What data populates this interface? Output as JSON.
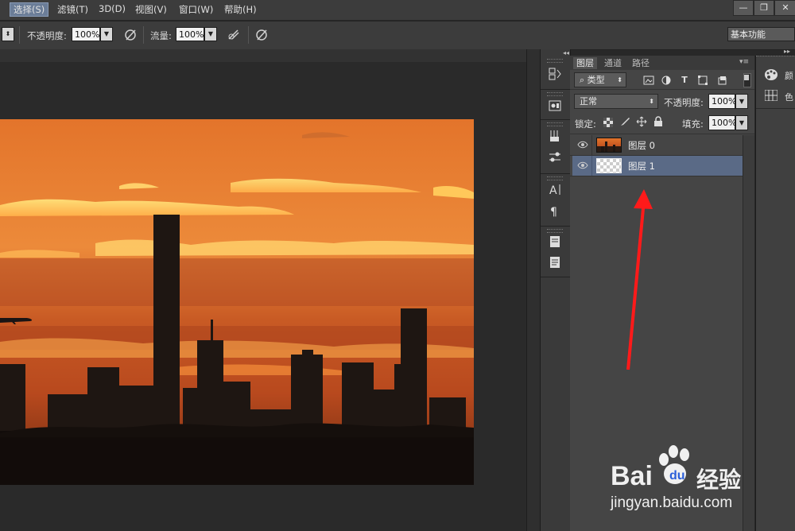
{
  "menubar": {
    "items": [
      "选择(S)",
      "滤镜(T)",
      "3D(D)",
      "视图(V)",
      "窗口(W)",
      "帮助(H)"
    ],
    "window_controls": [
      "—",
      "❐",
      "✕"
    ]
  },
  "options": {
    "opacity_label": "不透明度:",
    "opacity_value": "100%",
    "flow_label": "流量:",
    "flow_value": "100%",
    "workspace_value": "基本功能"
  },
  "layers_panel": {
    "tabs": [
      "图层",
      "通道",
      "路径"
    ],
    "filter_value": "类型",
    "blend_mode": "正常",
    "opacity_label": "不透明度:",
    "opacity_value": "100%",
    "lock_label": "锁定:",
    "fill_label": "填充:",
    "fill_value": "100%",
    "layers": [
      {
        "name": "图层 0",
        "selected": false
      },
      {
        "name": "图层 1",
        "selected": true
      }
    ]
  },
  "right_dock": {
    "items": [
      "颜",
      "色"
    ]
  },
  "watermark": {
    "brand_latin": "Bai",
    "brand_cn": "经验",
    "url": "jingyan.baidu.com"
  },
  "colors": {
    "selected_row": "#5a6a86",
    "arrow": "#ff1a1a",
    "sky_top": "#e87a2c",
    "sky_bottom": "#b04b1e"
  }
}
